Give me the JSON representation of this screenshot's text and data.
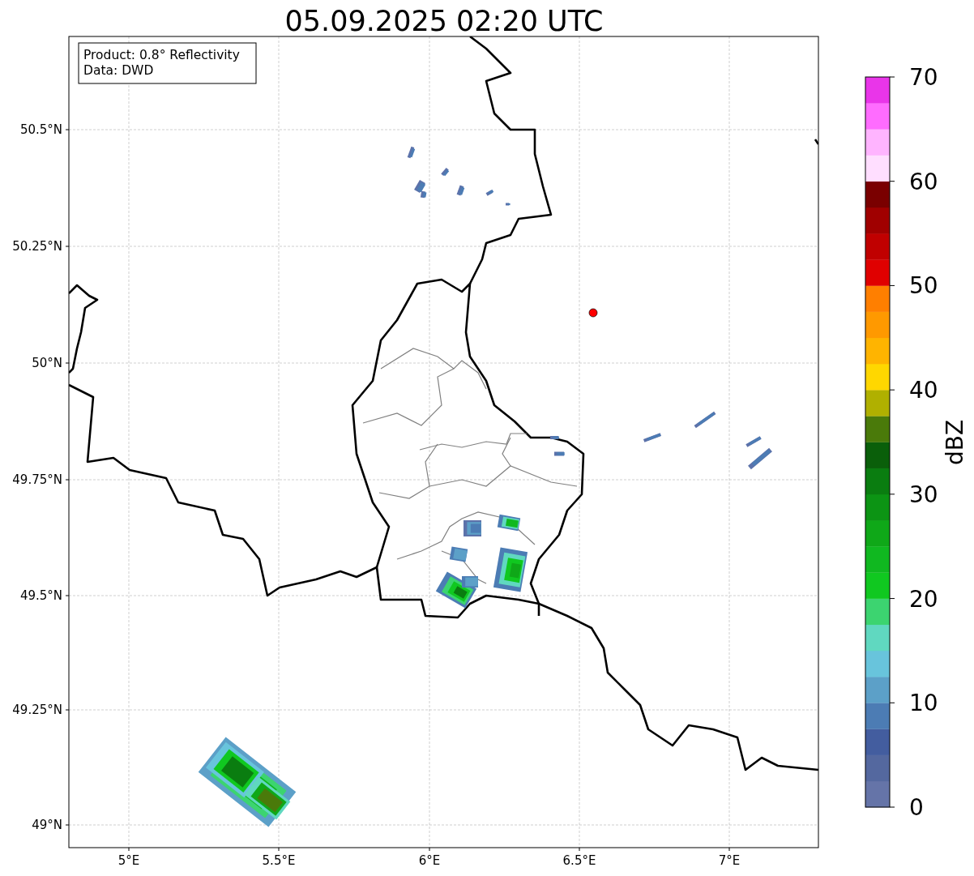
{
  "title": "05.09.2025 02:20 UTC",
  "legend": [
    "Product: 0.8° Reflectivity",
    "Data: DWD"
  ],
  "map": {
    "x_ticks": [
      "5°E",
      "5.5°E",
      "6°E",
      "6.5°E",
      "7°E"
    ],
    "y_ticks": [
      "50.5°N",
      "50.25°N",
      "50°N",
      "49.75°N",
      "49.5°N",
      "49.25°N",
      "49°N"
    ]
  },
  "colorbar": {
    "label": "dBZ",
    "ticks": [
      "70",
      "60",
      "50",
      "40",
      "30",
      "20",
      "10",
      "0"
    ],
    "segments": [
      {
        "color": "#6574a8"
      },
      {
        "color": "#54689f"
      },
      {
        "color": "#435d9f"
      },
      {
        "color": "#4c7cb4"
      },
      {
        "color": "#5ca0c8"
      },
      {
        "color": "#68c4dc"
      },
      {
        "color": "#60d8c0"
      },
      {
        "color": "#3cd470"
      },
      {
        "color": "#10c820"
      },
      {
        "color": "#10b820"
      },
      {
        "color": "#0fa818"
      },
      {
        "color": "#0c9414"
      },
      {
        "color": "#0a7d10"
      },
      {
        "color": "#0a5f0a"
      },
      {
        "color": "#4a7a0a"
      },
      {
        "color": "#b0b000"
      },
      {
        "color": "#ffd700"
      },
      {
        "color": "#ffb400"
      },
      {
        "color": "#ff9900"
      },
      {
        "color": "#ff7f00"
      },
      {
        "color": "#e00000"
      },
      {
        "color": "#c00000"
      },
      {
        "color": "#a00000"
      },
      {
        "color": "#7a0000"
      },
      {
        "color": "#ffdeff"
      },
      {
        "color": "#ffb4ff"
      },
      {
        "color": "#ff6cff"
      },
      {
        "color": "#e935e9"
      }
    ]
  }
}
